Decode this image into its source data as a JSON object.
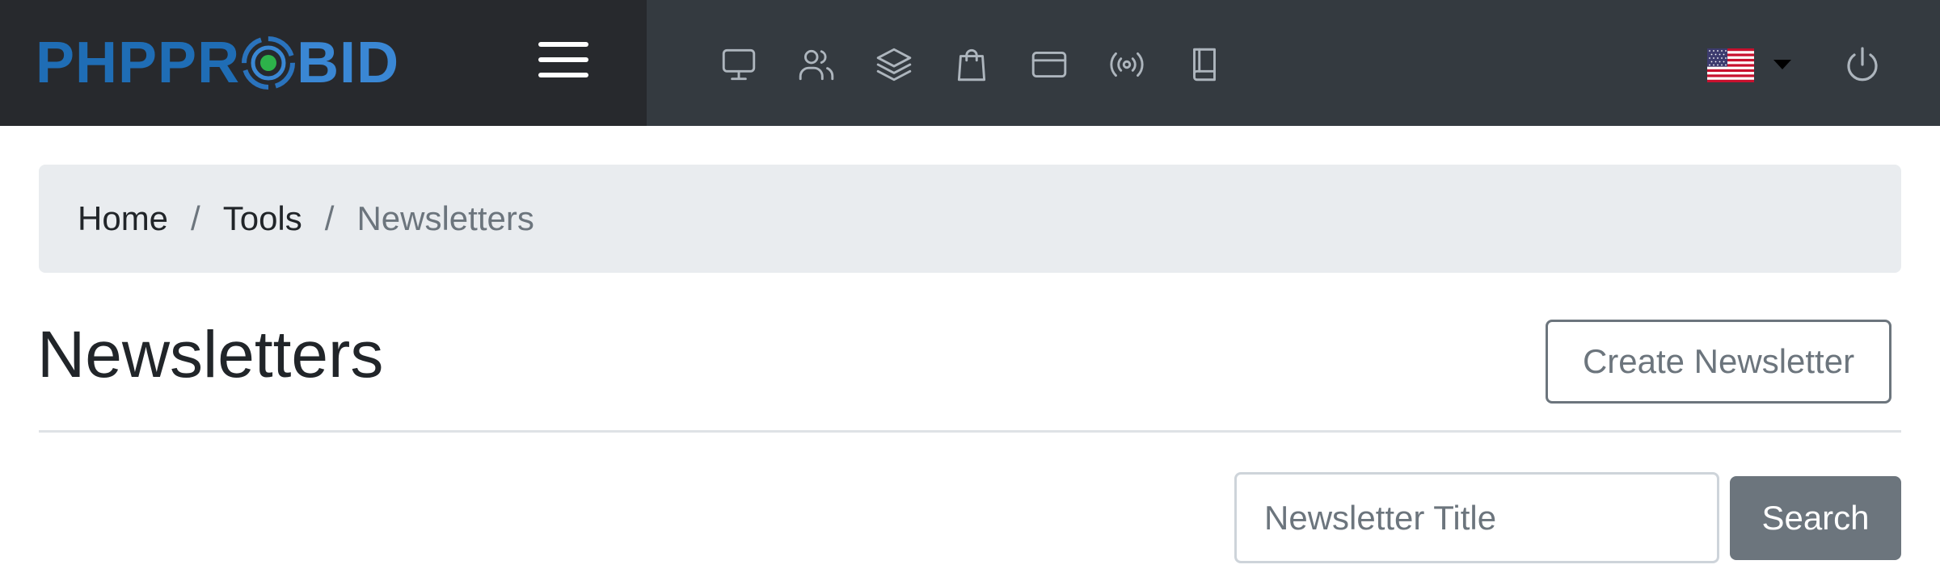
{
  "brand": {
    "logo_part1": "PHPPR",
    "logo_part2": "BID",
    "colors": {
      "logo_dark": "#1f6db5",
      "logo_light": "#3a87d4",
      "logo_target_center": "#2db34a"
    }
  },
  "navbar": {
    "background": "#343a40",
    "icons": [
      {
        "name": "monitor-icon"
      },
      {
        "name": "users-icon"
      },
      {
        "name": "layers-icon"
      },
      {
        "name": "shopping-bag-icon"
      },
      {
        "name": "credit-card-icon"
      },
      {
        "name": "broadcast-icon"
      },
      {
        "name": "book-icon"
      }
    ],
    "language_icon": "us-flag-icon",
    "logout_icon": "power-icon"
  },
  "breadcrumb": {
    "items": [
      "Home",
      "Tools"
    ],
    "active": "Newsletters",
    "separator": "/"
  },
  "page": {
    "title": "Newsletters",
    "create_button": "Create Newsletter"
  },
  "search": {
    "placeholder": "Newsletter Title",
    "value": "",
    "button": "Search"
  }
}
